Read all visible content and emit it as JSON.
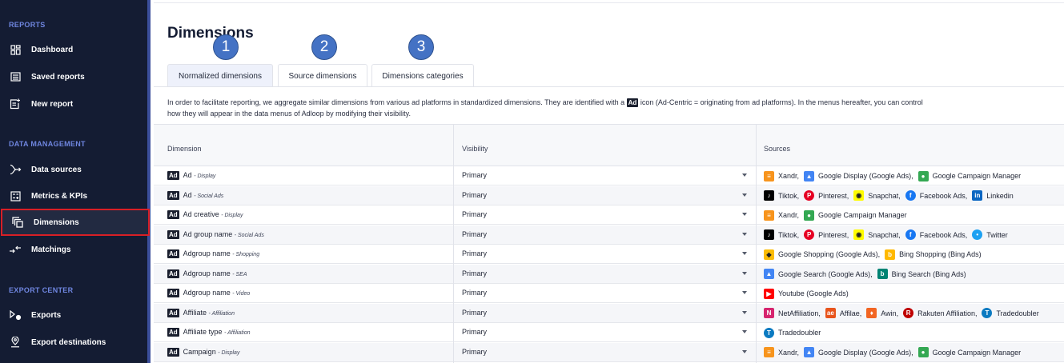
{
  "sidebar": {
    "sections": {
      "reports": "REPORTS",
      "data_management": "DATA MANAGEMENT",
      "export_center": "EXPORT CENTER"
    },
    "items": [
      {
        "label": "Dashboard",
        "icon": "dashboard-icon"
      },
      {
        "label": "Saved reports",
        "icon": "saved-reports-icon"
      },
      {
        "label": "New report",
        "icon": "new-report-icon"
      },
      {
        "label": "Data sources",
        "icon": "data-sources-icon"
      },
      {
        "label": "Metrics & KPIs",
        "icon": "metrics-icon"
      },
      {
        "label": "Dimensions",
        "icon": "dimensions-icon"
      },
      {
        "label": "Matchings",
        "icon": "matchings-icon"
      },
      {
        "label": "Exports",
        "icon": "exports-icon"
      },
      {
        "label": "Export destinations",
        "icon": "location-pin-icon"
      }
    ]
  },
  "page": {
    "title": "Dimensions",
    "tabs": [
      "Normalized dimensions",
      "Source dimensions",
      "Dimensions categories"
    ],
    "badges": [
      "1",
      "2",
      "3"
    ],
    "description_part1": "In order to facilitate reporting, we aggregate similar dimensions from various ad platforms in standardized dimensions. They are identified with a",
    "ad_tag": "Ad",
    "description_part2": "icon (Ad-Centric = originating from ad platforms). In the menus hereafter, you can control",
    "description_line2": "how they will appear in the data menus of Adloop by modifying their visibility."
  },
  "table": {
    "headers": [
      "Dimension",
      "Visibility",
      "Sources"
    ],
    "ad_tag": "Ad",
    "rows": [
      {
        "name": "Ad",
        "category": " - Display",
        "visibility": "Primary",
        "sources": [
          {
            "name": "Xandr,",
            "icon": "xandr-icon",
            "color": "#f7941d"
          },
          {
            "name": "Google Display (Google Ads),",
            "icon": "google-ads-icon",
            "color": "#4285f4"
          },
          {
            "name": "Google Campaign Manager",
            "icon": "campaign-manager-icon",
            "color": "#34a853"
          }
        ]
      },
      {
        "name": "Ad",
        "category": " - Social Ads",
        "visibility": "Primary",
        "sources": [
          {
            "name": "Tiktok,",
            "icon": "tiktok-icon",
            "color": "#000000"
          },
          {
            "name": "Pinterest,",
            "icon": "pinterest-icon",
            "color": "#e60023"
          },
          {
            "name": "Snapchat,",
            "icon": "snapchat-icon",
            "color": "#fffc00"
          },
          {
            "name": "Facebook Ads,",
            "icon": "facebook-ads-icon",
            "color": "#1877f2"
          },
          {
            "name": "Linkedin",
            "icon": "linkedin-icon",
            "color": "#0a66c2"
          }
        ]
      },
      {
        "name": "Ad creative",
        "category": " - Display",
        "visibility": "Primary",
        "sources": [
          {
            "name": "Xandr,",
            "icon": "xandr-icon",
            "color": "#f7941d"
          },
          {
            "name": "Google Campaign Manager",
            "icon": "campaign-manager-icon",
            "color": "#34a853"
          }
        ]
      },
      {
        "name": "Ad group name",
        "category": " - Social Ads",
        "visibility": "Primary",
        "sources": [
          {
            "name": "Tiktok,",
            "icon": "tiktok-icon",
            "color": "#000000"
          },
          {
            "name": "Pinterest,",
            "icon": "pinterest-icon",
            "color": "#e60023"
          },
          {
            "name": "Snapchat,",
            "icon": "snapchat-icon",
            "color": "#fffc00"
          },
          {
            "name": "Facebook Ads,",
            "icon": "facebook-ads-icon",
            "color": "#1877f2"
          },
          {
            "name": "Twitter",
            "icon": "twitter-icon",
            "color": "#1da1f2"
          }
        ]
      },
      {
        "name": "Adgroup name",
        "category": " - Shopping",
        "visibility": "Primary",
        "sources": [
          {
            "name": "Google Shopping (Google Ads),",
            "icon": "google-shopping-icon",
            "color": "#fbbc05"
          },
          {
            "name": "Bing Shopping (Bing Ads)",
            "icon": "bing-icon",
            "color": "#ffb900"
          }
        ]
      },
      {
        "name": "Adgroup name",
        "category": " - SEA",
        "visibility": "Primary",
        "sources": [
          {
            "name": "Google Search (Google Ads),",
            "icon": "google-ads-icon",
            "color": "#4285f4"
          },
          {
            "name": "Bing Search (Bing Ads)",
            "icon": "bing-icon",
            "color": "#008373"
          }
        ]
      },
      {
        "name": "Adgroup name",
        "category": " - Video",
        "visibility": "Primary",
        "sources": [
          {
            "name": "Youtube (Google Ads)",
            "icon": "youtube-icon",
            "color": "#ff0000"
          }
        ]
      },
      {
        "name": "Affiliate",
        "category": " - Affiliation",
        "visibility": "Primary",
        "sources": [
          {
            "name": "NetAffiliation,",
            "icon": "netaffiliation-icon",
            "color": "#d6246e"
          },
          {
            "name": "Affilae,",
            "icon": "affilae-icon",
            "color": "#e8541c"
          },
          {
            "name": "Awin,",
            "icon": "awin-icon",
            "color": "#f26522"
          },
          {
            "name": "Rakuten Affiliation,",
            "icon": "rakuten-icon",
            "color": "#bf0000"
          },
          {
            "name": "Tradedoubler",
            "icon": "tradedoubler-icon",
            "color": "#0b7ac1"
          }
        ]
      },
      {
        "name": "Affiliate type",
        "category": " - Affiliation",
        "visibility": "Primary",
        "sources": [
          {
            "name": "Tradedoubler",
            "icon": "tradedoubler-icon",
            "color": "#0b7ac1"
          }
        ]
      },
      {
        "name": "Campaign",
        "category": " - Display",
        "visibility": "Primary",
        "sources": [
          {
            "name": "Xandr,",
            "icon": "xandr-icon",
            "color": "#f7941d"
          },
          {
            "name": "Google Display (Google Ads),",
            "icon": "google-ads-icon",
            "color": "#4285f4"
          },
          {
            "name": "Google Campaign Manager",
            "icon": "campaign-manager-icon",
            "color": "#34a853"
          }
        ]
      }
    ]
  }
}
